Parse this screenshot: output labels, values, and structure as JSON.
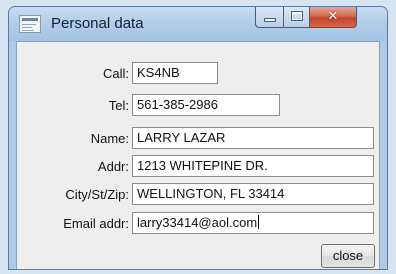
{
  "window": {
    "title": "Personal data",
    "controls": {
      "minimize": "minimize-icon",
      "maximize": "maximize-icon",
      "close": "close-icon"
    }
  },
  "form": {
    "call": {
      "label": "Call:",
      "value": "KS4NB"
    },
    "tel": {
      "label": "Tel:",
      "value": "561-385-2986"
    },
    "name": {
      "label": "Name:",
      "value": "LARRY LAZAR"
    },
    "addr": {
      "label": "Addr:",
      "value": "1213 WHITEPINE DR."
    },
    "city": {
      "label": "City/St/Zip:",
      "value": "WELLINGTON, FL 33414"
    },
    "email": {
      "label": "Email addr:",
      "value": "larry33414@aol.com"
    }
  },
  "buttons": {
    "close_label": "close"
  },
  "colors": {
    "titlebar": "#b1cdea",
    "close_button": "#c1442b",
    "client_background": "#eeeeee"
  }
}
